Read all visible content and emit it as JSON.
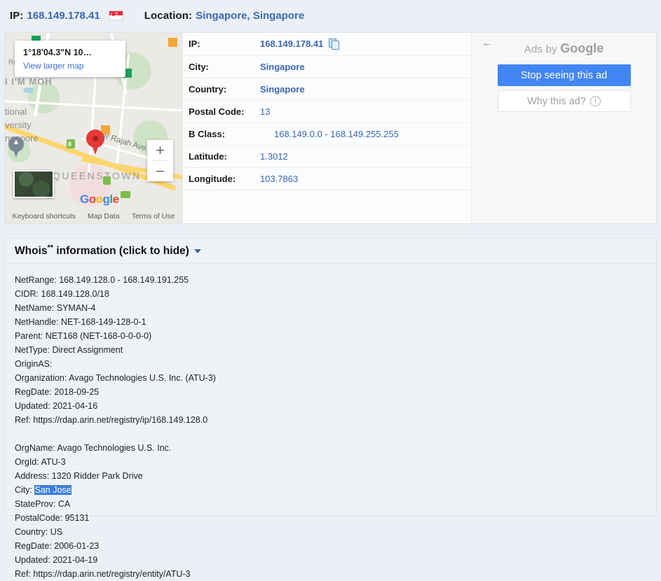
{
  "header": {
    "ip_label": "IP:",
    "ip_value": "168.149.178.41",
    "flag_icon": "singapore-flag-icon",
    "location_label": "Location:",
    "location_value": "Singapore, Singapore"
  },
  "map": {
    "popup_coords": "1°18'04.3\"N 10…",
    "view_larger": "View larger map",
    "zoom_in": "+",
    "zoom_out": "−",
    "labels": {
      "queenstown": "QUEENSTOWN",
      "ayer_rajah": "Ayer Rajah Ave",
      "national": "tional",
      "versity": "versity",
      "ngapore": "ngapore",
      "moh": "I I'M MOH",
      "rd": "Rd",
      "route8": "8"
    },
    "brand": "Google",
    "footer": [
      "Keyboard shortcuts",
      "Map Data",
      "Terms of Use"
    ]
  },
  "info_table": {
    "rows": [
      {
        "key": "IP:",
        "value": "168.149.178.41",
        "copy": true,
        "bold": true,
        "indent": false
      },
      {
        "key": "City:",
        "value": "Singapore",
        "copy": false,
        "bold": true,
        "indent": false
      },
      {
        "key": "Country:",
        "value": "Singapore",
        "copy": false,
        "bold": true,
        "indent": false
      },
      {
        "key": "Postal Code:",
        "value": "13",
        "copy": false,
        "bold": false,
        "indent": false
      },
      {
        "key": "B Class:",
        "value": "168.149.0.0 - 168.149.255.255",
        "copy": false,
        "bold": false,
        "indent": true
      },
      {
        "key": "Latitude:",
        "value": "1.3012",
        "copy": false,
        "bold": false,
        "indent": false
      },
      {
        "key": "Longitude:",
        "value": "103.7863",
        "copy": false,
        "bold": false,
        "indent": false
      }
    ],
    "copy_icon": "copy-icon"
  },
  "ads": {
    "back_icon": "back-arrow-icon",
    "by_prefix": "Ads by ",
    "by_brand": "Google",
    "stop_label": "Stop seeing this ad",
    "why_label": "Why this ad?",
    "info_icon": "info-icon",
    "accent_color": "#4285f4"
  },
  "whois": {
    "title": "Whois",
    "title_sup": "**",
    "title_rest": " information (click to hide)",
    "caret_icon": "chevron-down-icon",
    "block1_pre": "NetRange: 168.149.128.0 - 168.149.191.255\nCIDR: 168.149.128.0/18\nNetName: SYMAN-4\nNetHandle: NET-168-149-128-0-1\nParent: NET168 (NET-168-0-0-0-0)\nNetType: Direct Assignment\nOriginAS:\nOrganization: Avago Technologies U.S. Inc. (ATU-3)\nRegDate: 2018-09-25\nUpdated: 2021-04-16\nRef: https://rdap.arin.net/registry/ip/168.149.128.0\n\nOrgName: Avago Technologies U.S. Inc.\nOrgId: ATU-3\nAddress: 1320 Ridder Park Drive\nCity: ",
    "selected_text": "San Jose",
    "block1_post": "\nStateProv: CA\nPostalCode: 95131\nCountry: US\nRegDate: 2006-01-23\nUpdated: 2021-04-19\nRef: https://rdap.arin.net/registry/entity/ATU-3",
    "selection_color": "#3b7ddd"
  }
}
